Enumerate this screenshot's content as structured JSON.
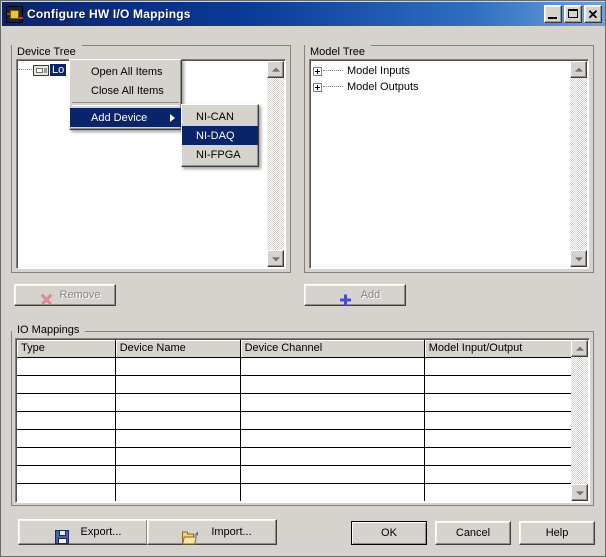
{
  "window": {
    "title": "Configure HW I/O Mappings",
    "icon": "labview-icon",
    "buttons": {
      "minimize": "_",
      "maximize": "□",
      "close": "✕"
    }
  },
  "device_tree": {
    "group_title": "Device Tree",
    "nodes": [
      {
        "label": "Lo",
        "icon": "device-icon",
        "selected": true
      }
    ]
  },
  "model_tree": {
    "group_title": "Model Tree",
    "nodes": [
      {
        "label": "Model Inputs",
        "expander": "plus"
      },
      {
        "label": "Model Outputs",
        "expander": "plus"
      }
    ]
  },
  "actions": {
    "remove_label": "Remove",
    "remove_icon": "x-icon",
    "remove_disabled": true,
    "add_label": "Add",
    "add_icon": "plus-icon",
    "add_disabled": true
  },
  "io_mappings": {
    "group_title": "IO Mappings",
    "columns": [
      "Type",
      "Device Name",
      "Device Channel",
      "Model Input/Output"
    ],
    "rows": [
      [
        "",
        "",
        "",
        ""
      ],
      [
        "",
        "",
        "",
        ""
      ],
      [
        "",
        "",
        "",
        ""
      ],
      [
        "",
        "",
        "",
        ""
      ],
      [
        "",
        "",
        "",
        ""
      ],
      [
        "",
        "",
        "",
        ""
      ],
      [
        "",
        "",
        "",
        ""
      ],
      [
        "",
        "",
        "",
        ""
      ],
      [
        "",
        "",
        "",
        ""
      ]
    ]
  },
  "context_menu": {
    "items": [
      {
        "label": "Open All Items",
        "highlighted": false,
        "has_submenu": false
      },
      {
        "label": "Close All Items",
        "highlighted": false,
        "has_submenu": false
      },
      {
        "separator": true
      },
      {
        "label": "Add Device",
        "highlighted": true,
        "has_submenu": true
      }
    ],
    "submenu": {
      "items": [
        {
          "label": "NI-CAN",
          "highlighted": false
        },
        {
          "label": "NI-DAQ",
          "highlighted": true
        },
        {
          "label": "NI-FPGA",
          "highlighted": false
        }
      ]
    }
  },
  "footer": {
    "export_label": "Export...",
    "export_icon": "floppy-disk-icon",
    "import_label": "Import...",
    "import_icon": "open-folder-icon",
    "ok_label": "OK",
    "cancel_label": "Cancel",
    "help_label": "Help"
  },
  "colors": {
    "dialog_bg": "#d6d3ce",
    "titlebar_start": "#0a246a",
    "titlebar_end": "#6ea3dd",
    "selection": "#0a246a",
    "disabled_text": "#848484"
  }
}
